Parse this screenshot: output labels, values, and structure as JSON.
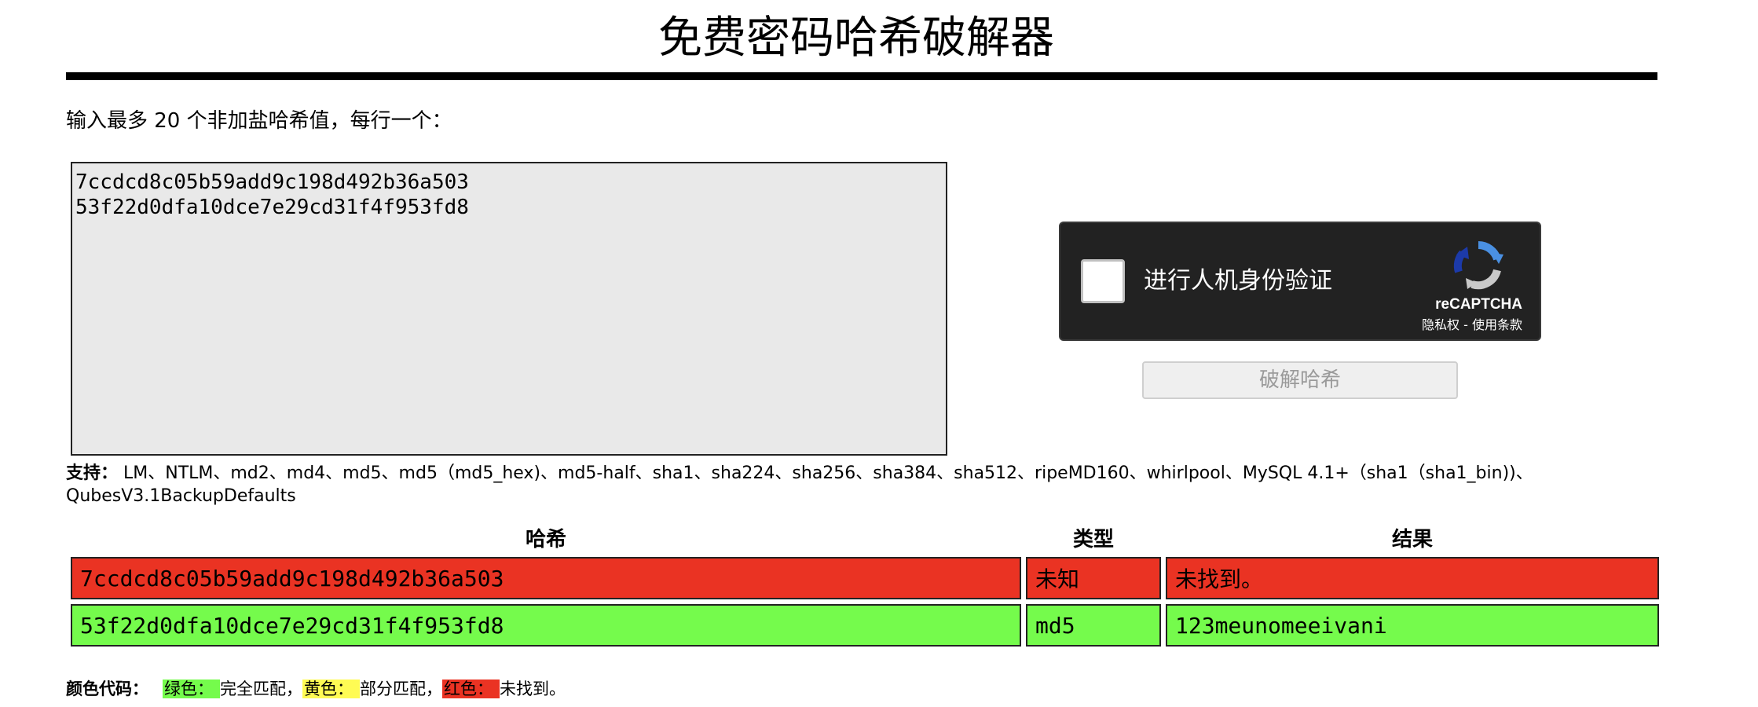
{
  "page": {
    "title": "免费密码哈希破解器",
    "instruction": "输入最多 20 个非加盐哈希值，每行一个：",
    "input_value": "7ccdcd8c05b59add9c198d492b36a503\n53f22d0dfa10dce7e29cd31f4f953fd8"
  },
  "captcha": {
    "label": "进行人机身份验证",
    "brand": "reCAPTCHA",
    "links": "隐私权 - 使用条款"
  },
  "crack_button_label": "破解哈希",
  "support": {
    "label": "支持：",
    "text": " LM、NTLM、md2、md4、md5、md5（md5_hex)、md5-half、sha1、sha224、sha256、sha384、sha512、ripeMD160、whirlpool、MySQL 4.1+（sha1（sha1_bin))、QubesV3.1BackupDefaults"
  },
  "results": {
    "headers": [
      "哈希",
      "类型",
      "结果"
    ],
    "rows": [
      {
        "hash": "7ccdcd8c05b59add9c198d492b36a503",
        "type": "未知",
        "result": "未找到。",
        "status": "red"
      },
      {
        "hash": "53f22d0dfa10dce7e29cd31f4f953fd8",
        "type": "md5",
        "result": "123meunomeeivani",
        "status": "green"
      }
    ]
  },
  "legend": {
    "label": "颜色代码：",
    "green_label": "绿色：",
    "green_text": "完全匹配，",
    "yellow_label": "黄色：",
    "yellow_text": "部分匹配，",
    "red_label": "红色：",
    "red_text": "未找到。"
  },
  "colors": {
    "not_found": "#ea3323",
    "found": "#75fb4c",
    "partial": "#fffb54",
    "captcha_bg": "#222222"
  },
  "icons": {
    "captcha_logo": "recaptcha-logo-icon"
  }
}
